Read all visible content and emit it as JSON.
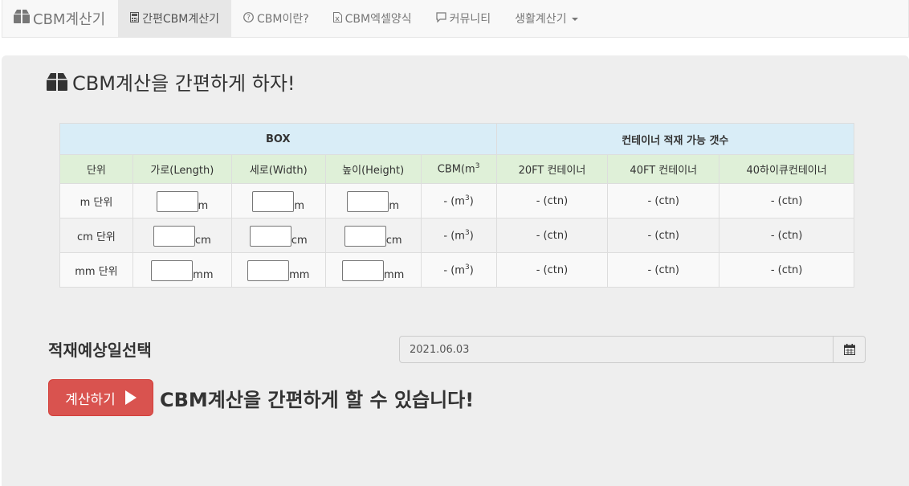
{
  "navbar": {
    "brand": "CBM계산기",
    "items": [
      {
        "label": "간편CBM계산기",
        "icon": "calculator-icon",
        "active": true
      },
      {
        "label": "CBM이란?",
        "icon": "question-circle-icon"
      },
      {
        "label": "CBM엑셀양식",
        "icon": "excel-file-icon"
      },
      {
        "label": "커뮤니티",
        "icon": "comment-icon"
      },
      {
        "label": "생활계산기",
        "icon": "caret-down-icon"
      }
    ]
  },
  "main": {
    "title": "CBM계산을 간편하게 하자!",
    "table": {
      "group_box": "BOX",
      "group_container": "컨테이너 적재 가능 갯수",
      "headers": {
        "unit": "단위",
        "length": "가로(Length)",
        "width": "세로(Width)",
        "height": "높이(Height)",
        "cbm": "CBM(m",
        "cbm_sup": "3",
        "ft20": "20FT 컨테이너",
        "ft40": "40FT 컨테이너",
        "hc40": "40하이큐컨테이너"
      },
      "rows": [
        {
          "unit": "m 단위",
          "suffix": "m",
          "cbm": "- (m",
          "cbm_sup": "3",
          "ft20": "- (ctn)",
          "ft40": "- (ctn)",
          "hc40": "- (ctn)"
        },
        {
          "unit": "cm 단위",
          "suffix": "cm",
          "cbm": "- (m",
          "cbm_sup": "3",
          "ft20": "- (ctn)",
          "ft40": "- (ctn)",
          "hc40": "- (ctn)"
        },
        {
          "unit": "mm 단위",
          "suffix": "mm",
          "cbm": "- (m",
          "cbm_sup": "3",
          "ft20": "- (ctn)",
          "ft40": "- (ctn)",
          "hc40": "- (ctn)"
        }
      ]
    },
    "date_label": "적재예상일선택",
    "date_value": "2021.06.03",
    "calc_button": "계산하기",
    "slogan": "CBM계산을 간편하게 할 수 있습니다!"
  },
  "colors": {
    "header_blue": "#d9edf7",
    "header_green": "#dff0d8",
    "button_red": "#d9534f"
  }
}
